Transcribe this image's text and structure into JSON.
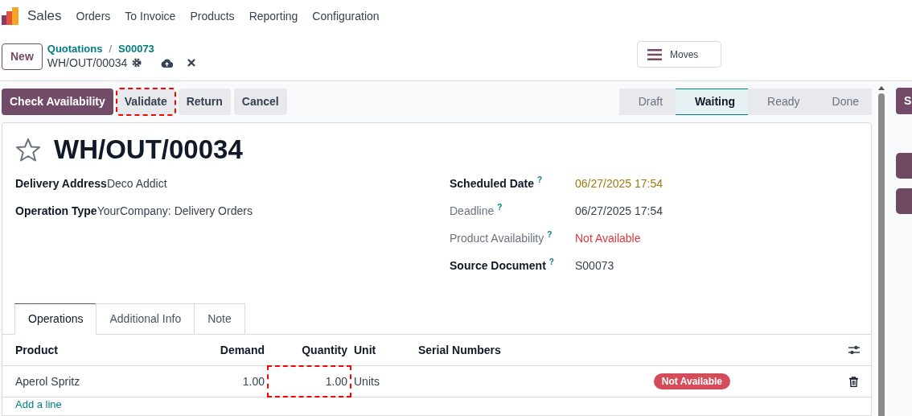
{
  "navbar": {
    "app": "Sales",
    "menu": [
      "Orders",
      "To Invoice",
      "Products",
      "Reporting",
      "Configuration"
    ]
  },
  "control_panel": {
    "new_button": "New",
    "breadcrumbs": [
      "Quotations",
      "S00073"
    ],
    "breadcrumb_separator": "/",
    "record": "WH/OUT/00034",
    "moves_button": "Moves"
  },
  "actions": [
    {
      "label": "Check Availability",
      "kind": "primary",
      "highlighted": false
    },
    {
      "label": "Validate",
      "kind": "secondary",
      "highlighted": true
    },
    {
      "label": "Return",
      "kind": "secondary",
      "highlighted": false
    },
    {
      "label": "Cancel",
      "kind": "secondary",
      "highlighted": false
    }
  ],
  "statusbar": [
    {
      "label": "Draft",
      "selected": false
    },
    {
      "label": "Waiting",
      "selected": true
    },
    {
      "label": "Ready",
      "selected": false
    },
    {
      "label": "Done",
      "selected": false
    }
  ],
  "form": {
    "title": "WH/OUT/00034",
    "starred": false,
    "left_fields": [
      {
        "label": "Delivery Address",
        "value": "Deco Addict",
        "color": "#374151",
        "label_muted": false
      },
      {
        "label": "Operation Type",
        "value": "YourCompany: Delivery Orders",
        "color": "#374151",
        "label_muted": false
      }
    ],
    "right_fields": [
      {
        "label": "Scheduled Date",
        "value": "06/27/2025 17:54",
        "help_mark": "?",
        "color": "#a0790b",
        "label_muted": false
      },
      {
        "label": "Deadline",
        "value": "06/27/2025 17:54",
        "help_mark": "?",
        "color": "#374151",
        "label_muted": true
      },
      {
        "label": "Product Availability",
        "value": "Not Available",
        "help_mark": "?",
        "color": "#d9383e",
        "label_muted": true
      },
      {
        "label": "Source Document",
        "value": "S00073",
        "help_mark": "?",
        "color": "#374151",
        "label_muted": false
      }
    ]
  },
  "tabs": [
    {
      "label": "Operations",
      "selected": true
    },
    {
      "label": "Additional Info",
      "selected": false
    },
    {
      "label": "Note",
      "selected": false
    }
  ],
  "table": {
    "columns": [
      "Product",
      "Demand",
      "Quantity",
      "Unit",
      "Serial Numbers"
    ],
    "rows": [
      {
        "product": "Aperol Spritz",
        "demand": "1.00",
        "quantity": "1.00",
        "quantity_highlighted": true,
        "unit": "Units",
        "status": "Not Available"
      }
    ],
    "add_line": "Add a line"
  },
  "chatter": {
    "button": "S"
  }
}
